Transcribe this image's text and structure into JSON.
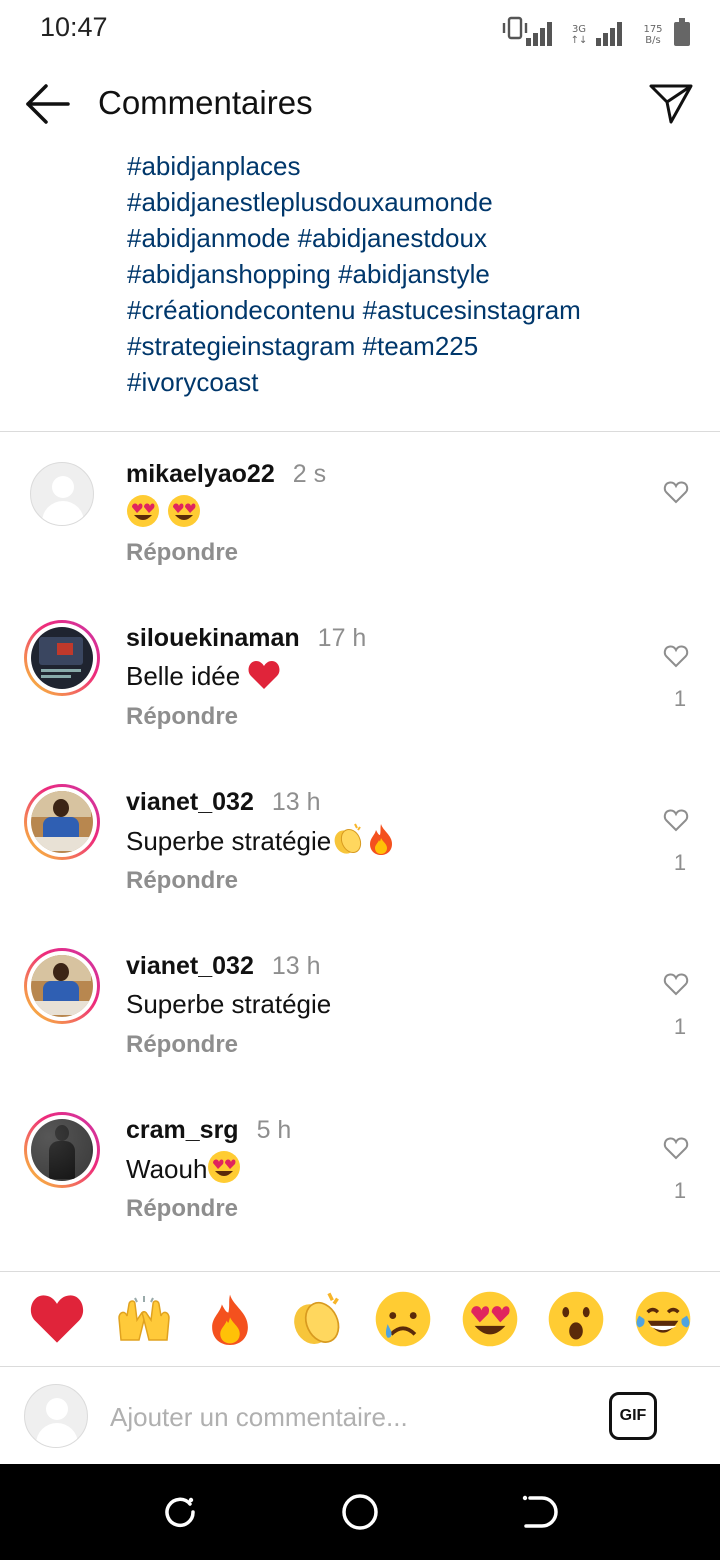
{
  "status_bar": {
    "time": "10:47",
    "network_label": "3G",
    "speed_value": "175",
    "speed_unit": "B/s"
  },
  "header": {
    "title": "Commentaires",
    "back_icon": "arrow-left-icon",
    "send_icon": "paper-plane-icon"
  },
  "caption": {
    "hashtag_lines": [
      "#abidjanplaces",
      "#abidjanestleplusdouxaumonde",
      "#abidjanmode #abidjanestdoux",
      "#abidjanshopping #abidjanstyle",
      "#créationdecontenu #astucesinstagram",
      "#strategieinstagram #team225",
      "#ivorycoast"
    ]
  },
  "comments": [
    {
      "username": "mikaelyao22",
      "time": "2 s",
      "text": "",
      "emojis": [
        "heart-eyes-emoji",
        "heart-eyes-emoji"
      ],
      "reply_label": "Répondre",
      "likes": "",
      "avatar": "default",
      "story_ring": false
    },
    {
      "username": "silouekinaman",
      "time": "17 h",
      "text": "Belle idée ",
      "emojis": [
        "red-heart-emoji"
      ],
      "reply_label": "Répondre",
      "likes": "1",
      "avatar": "photo-dark-screen",
      "story_ring": true
    },
    {
      "username": "vianet_032",
      "time": "13 h",
      "text": "Superbe stratégie",
      "emojis": [
        "clapping-hands-emoji",
        "fire-emoji"
      ],
      "reply_label": "Répondre",
      "likes": "1",
      "avatar": "photo-person-outdoor",
      "story_ring": true
    },
    {
      "username": "vianet_032",
      "time": "13 h",
      "text": "Superbe stratégie",
      "emojis": [],
      "reply_label": "Répondre",
      "likes": "1",
      "avatar": "photo-person-outdoor",
      "story_ring": true
    },
    {
      "username": "cram_srg",
      "time": "5 h",
      "text": "Waouh",
      "emojis": [
        "heart-eyes-emoji"
      ],
      "reply_label": "Répondre",
      "likes": "1",
      "avatar": "photo-person-dark",
      "story_ring": true
    }
  ],
  "emoji_bar": [
    "red-heart-emoji",
    "raising-hands-emoji",
    "fire-emoji",
    "clapping-hands-emoji",
    "sad-sweat-face-emoji",
    "heart-eyes-emoji",
    "surprised-face-emoji",
    "tears-of-joy-emoji"
  ],
  "input": {
    "placeholder": "Ajouter un commentaire...",
    "gif_label": "GIF"
  },
  "colors": {
    "hashtag": "#00376b",
    "muted": "#8e8e8e",
    "story_ring_start": "#f9ce34",
    "story_ring_end": "#c837ab"
  }
}
